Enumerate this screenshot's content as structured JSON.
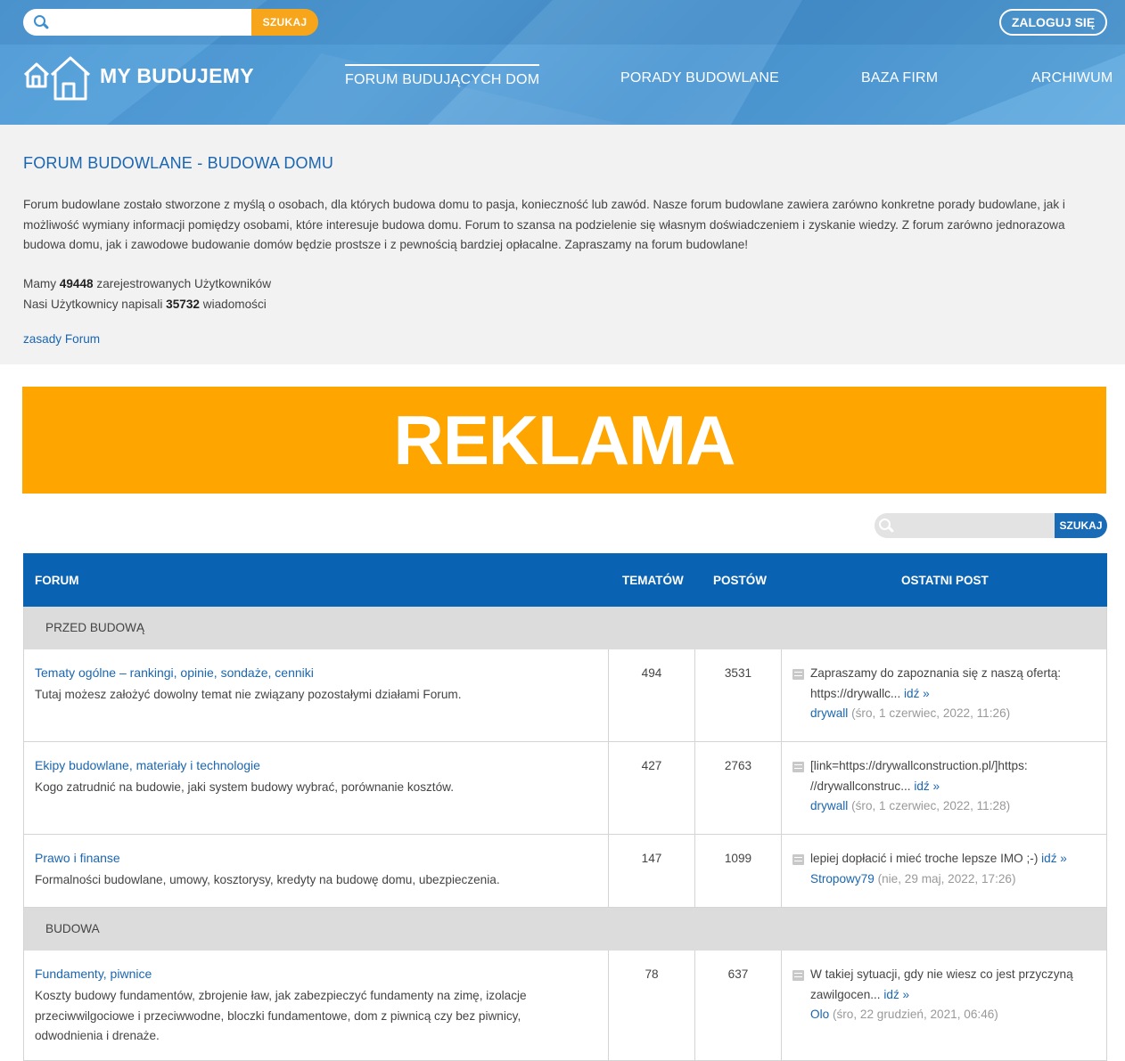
{
  "header": {
    "search_placeholder": "",
    "search_button": "SZUKAJ",
    "login_button": "ZALOGUJ SIĘ",
    "logo_text": "MY BUDUJEMY",
    "nav": [
      {
        "label": "FORUM BUDUJĄCYCH DOM",
        "active": true
      },
      {
        "label": "PORADY BUDOWLANE",
        "active": false
      },
      {
        "label": "BAZA FIRM",
        "active": false
      },
      {
        "label": "ARCHIWUM",
        "active": false
      }
    ]
  },
  "intro": {
    "title": "FORUM BUDOWLANE - BUDOWA DOMU",
    "description": "Forum budowlane zostało stworzone z myślą o osobach, dla których budowa domu to pasja, konieczność lub zawód. Nasze forum budowlane zawiera zarówno konkretne porady budowlane, jak i możliwość wymiany informacji pomiędzy osobami, które interesuje budowa domu. Forum to szansa na podzielenie się własnym doświadczeniem i zyskanie wiedzy. Z forum zarówno jednorazowa budowa domu, jak i zawodowe budowanie domów będzie prostsze i z pewnością bardziej opłacalne. Zapraszamy na forum budowlane!",
    "users_prefix": "Mamy",
    "users_count": "49448",
    "users_suffix": "zarejestrowanych Użytkowników",
    "posts_prefix": "Nasi Użytkownicy napisali",
    "posts_count": "35732",
    "posts_suffix": "wiadomości",
    "rules_link": "zasady Forum"
  },
  "ad": {
    "text": "REKLAMA"
  },
  "forum_search": {
    "placeholder": "",
    "button": "SZUKAJ"
  },
  "table": {
    "headers": {
      "forum": "FORUM",
      "topics": "TEMATÓW",
      "posts": "POSTÓW",
      "last_post": "OSTATNI POST"
    },
    "categories": [
      {
        "name": "PRZED BUDOWĄ",
        "forums": [
          {
            "title": "Tematy ogólne – rankingi, opinie, sondaże, cenniki",
            "description": "Tutaj możesz założyć dowolny temat nie związany pozostałymi działami Forum.",
            "topics": "494",
            "posts": "3531",
            "last_text": "Zapraszamy do zapoznania się z naszą ofertą: https://drywallc...",
            "last_link": "idź »",
            "last_author": "drywall",
            "last_meta": "(śro, 1 czerwiec, 2022, 11:26)"
          },
          {
            "title": "Ekipy budowlane, materiały i technologie",
            "description": "Kogo zatrudnić na budowie, jaki system budowy wybrać, porównanie kosztów.",
            "topics": "427",
            "posts": "2763",
            "last_text": "[link=https://drywallconstruction.pl/]https: //drywallconstruc...",
            "last_link": "idź »",
            "last_author": "drywall",
            "last_meta": "(śro, 1 czerwiec, 2022, 11:28)"
          },
          {
            "title": "Prawo i finanse",
            "description": "Formalności budowlane, umowy, kosztorysy, kredyty na budowę domu, ubezpieczenia.",
            "topics": "147",
            "posts": "1099",
            "last_text": "lepiej dopłacić i mieć troche lepsze IMO ;-)",
            "last_link": "idź »",
            "last_author": "Stropowy79",
            "last_meta": "(nie, 29 maj, 2022, 17:26)"
          }
        ]
      },
      {
        "name": "BUDOWA",
        "forums": [
          {
            "title": "Fundamenty, piwnice",
            "description": "Koszty budowy fundamentów, zbrojenie ław, jak zabezpieczyć fundamenty na zimę, izolacje przeciwwilgociowe i przeciwwodne, bloczki fundamentowe, dom z piwnicą czy bez piwnicy, odwodnienia i drenaże.",
            "topics": "78",
            "posts": "637",
            "last_text": "W takiej sytuacji, gdy nie wiesz co jest przyczyną zawilgocen...",
            "last_link": "idź »",
            "last_author": "Olo",
            "last_meta": "(śro, 22 grudzień, 2021, 06:46)"
          }
        ]
      }
    ]
  },
  "colors": {
    "header_blue": "#4a97d4",
    "accent_orange": "#f7a51b",
    "ad_orange": "#ffa500",
    "table_header": "#0a63b2",
    "link_blue": "#1a66b0",
    "category_gray": "#dcdcdc"
  }
}
